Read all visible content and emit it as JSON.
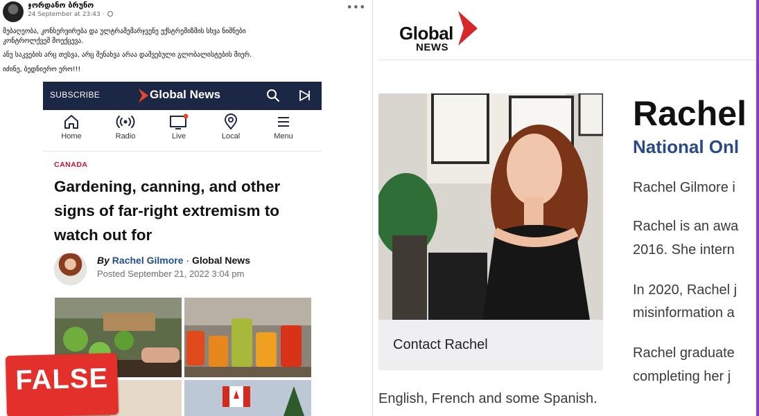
{
  "post": {
    "author": "ჯორდანო ბრუნო",
    "timestamp": "24 September at 23:43 ·",
    "more_label": "•••",
    "text_line1": "მებაღეობა, კონსერვირება და ულტრამემარჯვენე ექსტრემიზმის სხვა ნიშნები",
    "text_line2": "კონტროლქვეშ მოექცევა.",
    "text_line3": "ანუ საკვების არც თესვა, არც შენახვა არაა დაშვებული გლობალისტების მიერ.",
    "text_line4": "იძინე, ბედნიერო ერო!!!"
  },
  "article": {
    "subscribe_label": "SUBSCRIBE",
    "site_name": "Global News",
    "nav": [
      {
        "label": "Home",
        "icon": "home-icon"
      },
      {
        "label": "Radio",
        "icon": "radio-icon"
      },
      {
        "label": "Live",
        "icon": "live-tv-icon"
      },
      {
        "label": "Local",
        "icon": "location-pin-icon"
      },
      {
        "label": "Menu",
        "icon": "menu-icon"
      }
    ],
    "kicker": "CANADA",
    "headline": "Gardening, canning, and other signs of far-right extremism to watch out for",
    "by_prefix": "By",
    "author": "Rachel Gilmore",
    "separator": "·",
    "outlet": "Global News",
    "posted": "Posted September 21, 2022 3:04 pm"
  },
  "stamp": {
    "label": "FALSE",
    "color": "#e4302b"
  },
  "profile": {
    "brand_line1": "Global",
    "brand_line2": "NEWS",
    "contact_label": "Contact Rachel",
    "name": "Rachel",
    "title": "National Onl",
    "bio": [
      "Rachel Gilmore i",
      "Rachel is an awa",
      "2016. She intern",
      "In 2020, Rachel j",
      "misinformation a",
      "Rachel graduate",
      "completing her j"
    ],
    "bio_bottom": "English, French and some Spanish.",
    "colors": {
      "title_blue": "#2a4a86",
      "brand_red": "#d62828",
      "nav_bar": "#1c2645"
    }
  }
}
